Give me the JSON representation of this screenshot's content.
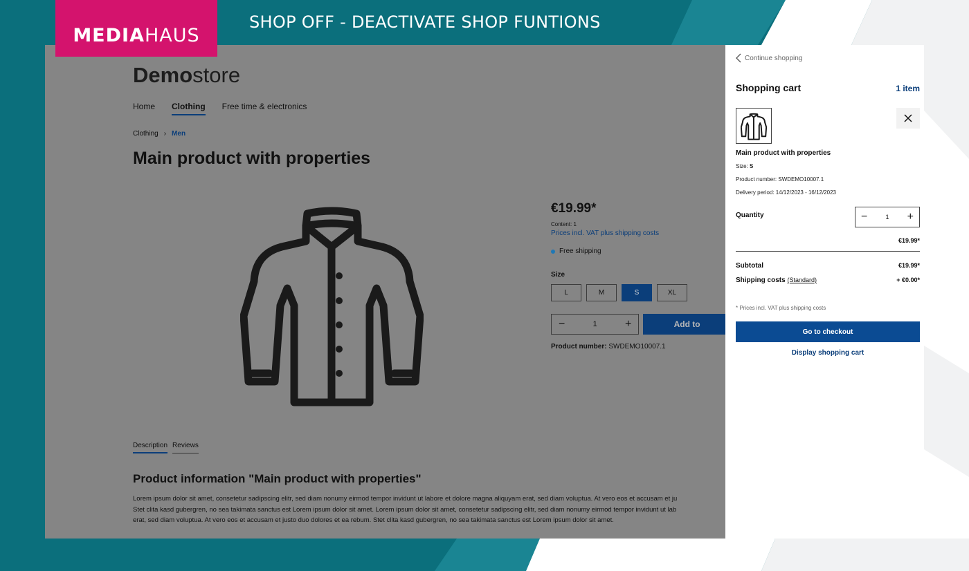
{
  "presentation": {
    "brand_bold": "MEDIA",
    "brand_light": "HAUS",
    "headline": "SHOP OFF - DEACTIVATE SHOP FUNTIONS",
    "colors": {
      "brand": "#d4136d",
      "background": "#0b6f7c",
      "shop_primary": "#0b3e7a"
    }
  },
  "store": {
    "logo_bold": "Demo",
    "logo_light": "store",
    "nav": [
      {
        "label": "Home"
      },
      {
        "label": "Clothing"
      },
      {
        "label": "Free time & electronics"
      }
    ],
    "active_nav": "Clothing",
    "breadcrumb": [
      "Clothing",
      "›",
      "Men"
    ],
    "product": {
      "title": "Main product with properties",
      "image_icon": "jacket-icon",
      "price": "€19.99*",
      "content": "Content: 1",
      "vat_link": "Prices incl. VAT plus shipping costs",
      "shipping": "Free shipping",
      "size_label": "Size",
      "sizes": [
        "L",
        "M",
        "S",
        "XL"
      ],
      "selected_size": "S",
      "qty_minus": "−",
      "qty_value": "1",
      "qty_plus": "+",
      "add_to_cart": "Add to",
      "product_number_label": "Product number:",
      "product_number": "SWDEMO10007.1"
    },
    "tabs": [
      "Description",
      "Reviews"
    ],
    "info_title": "Product information \"Main product with properties\"",
    "lorem_1": "Lorem ipsum dolor sit amet, consetetur sadipscing elitr, sed diam nonumy eirmod tempor invidunt ut labore et dolore magna aliquyam erat, sed diam voluptua. At vero eos et accusam et ju",
    "lorem_2": "Stet clita kasd gubergren, no sea takimata sanctus est Lorem ipsum dolor sit amet. Lorem ipsum dolor sit amet, consetetur sadipscing elitr, sed diam nonumy eirmod tempor invidunt ut lab",
    "lorem_3": "erat, sed diam voluptua. At vero eos et accusam et justo duo dolores et ea rebum. Stet clita kasd gubergren, no sea takimata sanctus est Lorem ipsum dolor sit amet."
  },
  "cart": {
    "continue": "Continue shopping",
    "title": "Shopping cart",
    "count": "1 item",
    "item_name": "Main product with properties",
    "size_label": "Size:",
    "size_value": "S",
    "product_number": "Product number: SWDEMO10007.1",
    "delivery": "Delivery period: 14/12/2023 - 16/12/2023",
    "quantity_label": "Quantity",
    "qty_minus": "−",
    "qty_value": "1",
    "qty_plus": "+",
    "line_price": "€19.99*",
    "subtotal_label": "Subtotal",
    "subtotal_value": "€19.99*",
    "shipping_label": "Shipping costs",
    "shipping_method": "(Standard)",
    "shipping_value": "+ €0.00*",
    "vat_note": "* Prices incl. VAT plus shipping costs",
    "checkout": "Go to checkout",
    "display_cart": "Display shopping cart"
  }
}
